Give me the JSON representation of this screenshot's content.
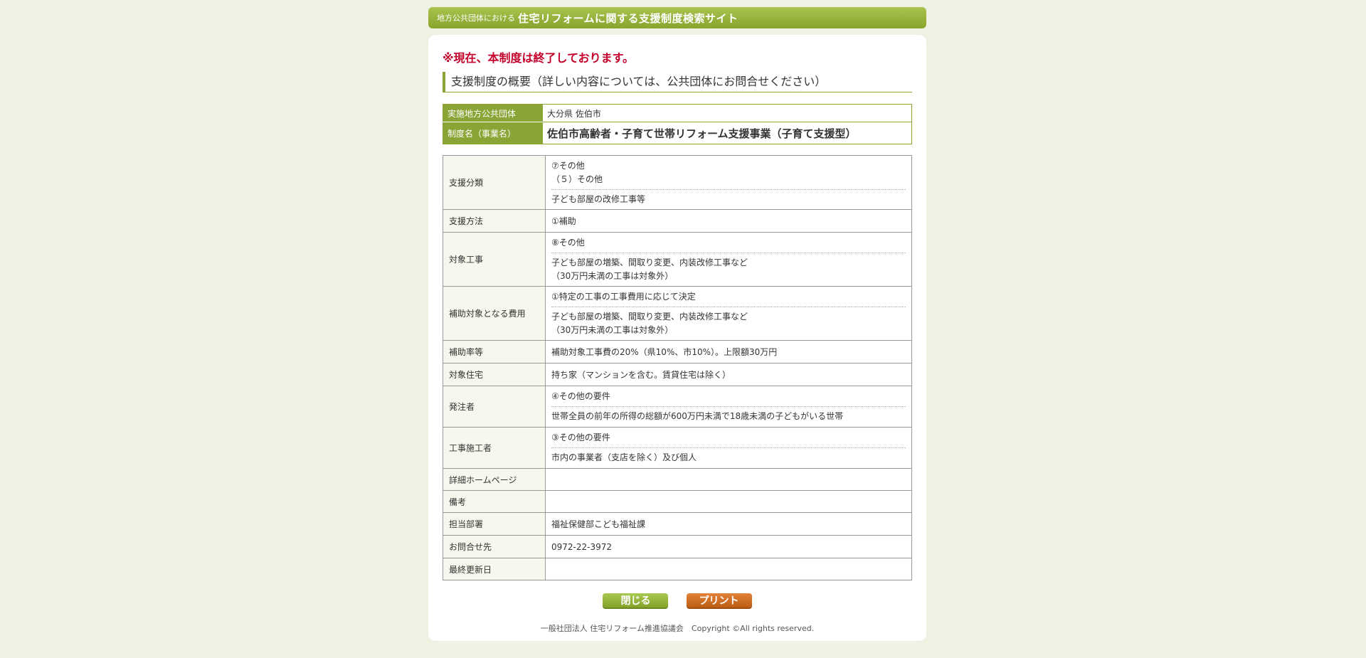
{
  "header": {
    "prefix": "地方公共団体における",
    "title": "住宅リフォームに関する支援制度検索サイト"
  },
  "notice": "※現在、本制度は終了しております。",
  "section_heading": "支援制度の概要（詳しい内容については、公共団体にお問合せください）",
  "summary": {
    "org_label": "実施地方公共団体",
    "org_value": "大分県 佐伯市",
    "program_label": "制度名（事業名）",
    "program_value": "佐伯市高齢者・子育て世帯リフォーム支援事業（子育て支援型）"
  },
  "details": {
    "support_category": {
      "label": "支援分類",
      "lines": [
        "⑦その他",
        "（５）その他"
      ],
      "note": "子ども部屋の改修工事等"
    },
    "support_method": {
      "label": "支援方法",
      "value": "①補助"
    },
    "target_work": {
      "label": "対象工事",
      "value": "⑧その他",
      "note_lines": [
        "子ども部屋の増築、間取り変更、内装改修工事など",
        "（30万円未満の工事は対象外）"
      ]
    },
    "subsidy_cost": {
      "label": "補助対象となる費用",
      "value": "①特定の工事の工事費用に応じて決定",
      "note_lines": [
        "子ども部屋の増築、間取り変更、内装改修工事など",
        "（30万円未満の工事は対象外）"
      ]
    },
    "subsidy_rate": {
      "label": "補助率等",
      "value": "補助対象工事費の20%（県10%、市10%）。上限額30万円"
    },
    "target_housing": {
      "label": "対象住宅",
      "value": "持ち家（マンションを含む。賃貸住宅は除く）"
    },
    "orderer": {
      "label": "発注者",
      "value": "④その他の要件",
      "note": "世帯全員の前年の所得の総額が600万円未満で18歳未満の子どもがいる世帯"
    },
    "contractor": {
      "label": "工事施工者",
      "value": "③その他の要件",
      "note": "市内の事業者（支店を除く）及び個人"
    },
    "homepage": {
      "label": "詳細ホームページ",
      "value": ""
    },
    "remarks": {
      "label": "備考",
      "value": ""
    },
    "department": {
      "label": "担当部署",
      "value": "福祉保健部こども福祉課"
    },
    "contact": {
      "label": "お問合せ先",
      "value": "0972-22-3972"
    },
    "last_updated": {
      "label": "最終更新日",
      "value": ""
    }
  },
  "buttons": {
    "close": "閉じる",
    "print": "プリント"
  },
  "footer": "一般社団法人 住宅リフォーム推進協議会　Copyright ©All rights reserved."
}
